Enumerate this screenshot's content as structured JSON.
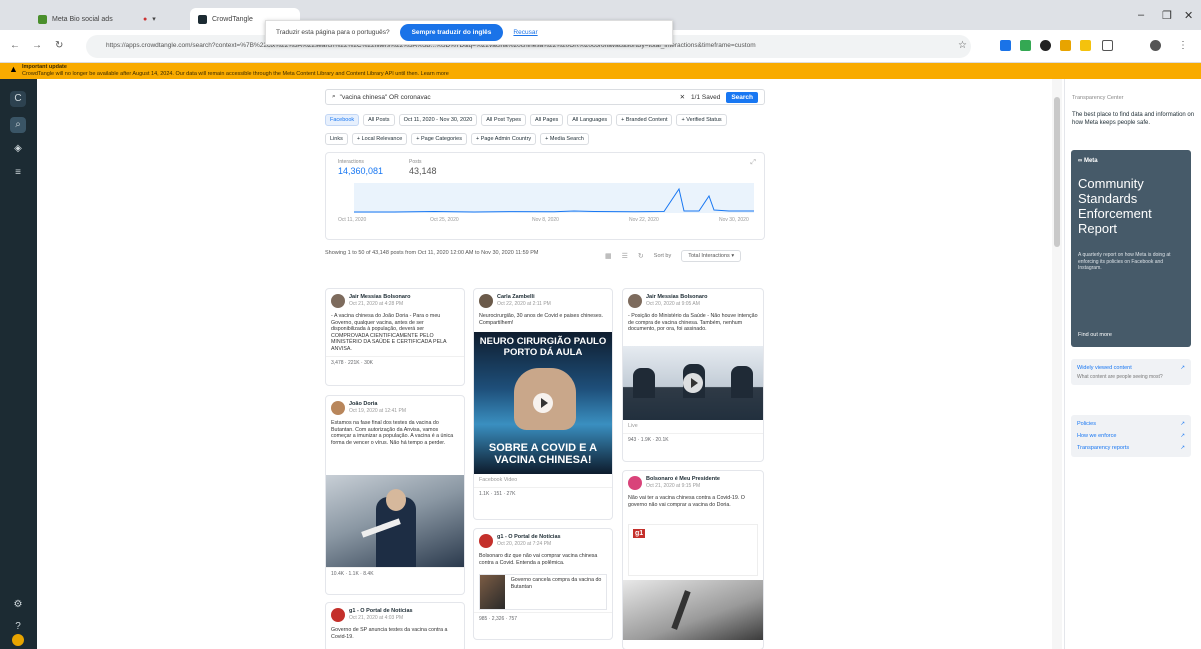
{
  "browser": {
    "tabs": [
      {
        "label": "Meta Bio social ads",
        "active": false
      },
      {
        "label": "CrowdTangle",
        "active": true
      }
    ],
    "url": "https://apps.crowdtangle.com/search?context=%7B%22ctx%22%3A%22search%22%2C%22filters%22%3A%5B...%5D%7D&q=%22vacina%20chinesa%22%20OR%20coronavac&sortBy=total_interactions&timeframe=custom",
    "window_controls": [
      "–",
      "❐",
      "✕"
    ]
  },
  "translate_popup": {
    "message": "Traduzir esta página para o português?",
    "button": "Sempre traduzir do inglês",
    "link": "Recusar"
  },
  "warning_bar": {
    "title": "Important update",
    "text": "CrowdTangle will no longer be available after August 14, 2024. Our data will remain accessible through the Meta Content Library and Content Library API until then. Learn more"
  },
  "search": {
    "query": "\"vacina chinesa\" OR coronavac",
    "saved_label": "1/1 Saved",
    "apply_label": "Search"
  },
  "filter_chips_row1": [
    "Facebook",
    "All Posts",
    "Oct 11, 2020 - Nov 30, 2020",
    "All Post Types",
    "All Pages",
    "All Languages",
    "+ Branded Content",
    "+ Verified Status"
  ],
  "filter_chips_row2": [
    "Links",
    "+ Local Relevance",
    "+ Page Categories",
    "+ Page Admin Country",
    "+ Media Search"
  ],
  "stats": {
    "interactions_label": "Interactions",
    "interactions_value": "14,360,081",
    "posts_label": "Posts",
    "posts_value": "43,148",
    "x_ticks": [
      "Oct 11, 2020",
      "Oct 25, 2020",
      "Nov 8, 2020",
      "Nov 22, 2020",
      "Nov 30, 2020"
    ]
  },
  "results": {
    "showing": "Showing 1 to 50 of 43,148 posts from Oct 11, 2020 12:00 AM to Nov 30, 2020 11:59 PM",
    "sort_label": "Sort by",
    "sort_value": "Total Interactions"
  },
  "posts": [
    {
      "name": "Jair Messias Bolsonaro",
      "date": "Oct 21, 2020 at 4:28 PM",
      "text": "- A vacina chinesa do João Doria - Para o meu Governo, qualquer vacina, antes de ser disponibilizada à população, deverá ser COMPROVADA CIENTIFICAMENTE PELO MINISTÉRIO DA SAÚDE E CERTIFICADA PELA ANVISA.",
      "stats": "3,478 · 221K · 30K"
    },
    {
      "name": "Carla Zambelli",
      "date": "Oct 22, 2020 at 2:11 PM",
      "text": "Neurocirurgião, 30 anos de Covid e paises chineses. Compartilhem!",
      "img_top": "NEURO CIRURGIÃO PAULO PORTO DÁ AULA",
      "img_bottom": "SOBRE A COVID E A VACINA CHINESA!",
      "video_label": "Facebook Video",
      "stats": "1.1K · 151 · 27K"
    },
    {
      "name": "Jair Messias Bolsonaro",
      "date": "Oct 20, 2020 at 9:05 AM",
      "text": "- Posição do Ministério da Saúde - Não houve intenção de compra de vacina chinesa. Também, nenhum documento, por ora, foi assinado.",
      "video_label": "Live",
      "stats": "943 · 1.9K · 20.1K"
    },
    {
      "name": "João Doria",
      "date": "Oct 19, 2020 at 12:41 PM",
      "text": "Estamos na fase final dos testes da vacina do Butantan. Com autorização da Anvisa, vamos começar a imunizar a população. A vacina é a única forma de vencer o vírus. Não há tempo a perder.",
      "stats": "10.4K · 1.1K · 8.4K"
    },
    {
      "name": "g1 - O Portal de Notícias",
      "date": "Oct 20, 2020 at 7:24 PM",
      "text": "Bolsonaro diz que não vai comprar vacina chinesa contra a Covid. Entenda a polêmica.",
      "link_title": "Governo cancela compra da vacina do Butantan",
      "stats": "985 · 2,326 · 757"
    },
    {
      "name": "Bolsonaro é Meu Presidente",
      "date": "Oct 21, 2020 at 9:15 PM",
      "text": "Não vai ter a vacina chinesa contra a Covid-19. O governo não vai comprar a vacina do Doria.",
      "stats": ""
    },
    {
      "name": "g1 - O Portal de Notícias",
      "date": "Oct 21, 2020 at 4:03 PM",
      "text": "Governo de SP anuncia testes da vacina contra a Covid-19.",
      "stats": ""
    }
  ],
  "right_panel": {
    "title": "Transparency Center",
    "intro": "The best place to find data and information on how Meta keeps people safe.",
    "brand": "∞ Meta",
    "card_title": "Community Standards Enforcement Report",
    "card_text": "A quarterly report on how Meta is doing at enforcing its policies on Facebook and Instagram.",
    "card_link": "Find out more",
    "widely_viewed": "Widely viewed content",
    "widely_viewed_sub": "What content are people seeing most?",
    "links": [
      "Policies",
      "How we enforce",
      "Transparency reports"
    ]
  },
  "colors": {
    "accent": "#1877f2",
    "warning": "#f9ab00",
    "nav": "#1c2b33",
    "card": "#465a69"
  }
}
